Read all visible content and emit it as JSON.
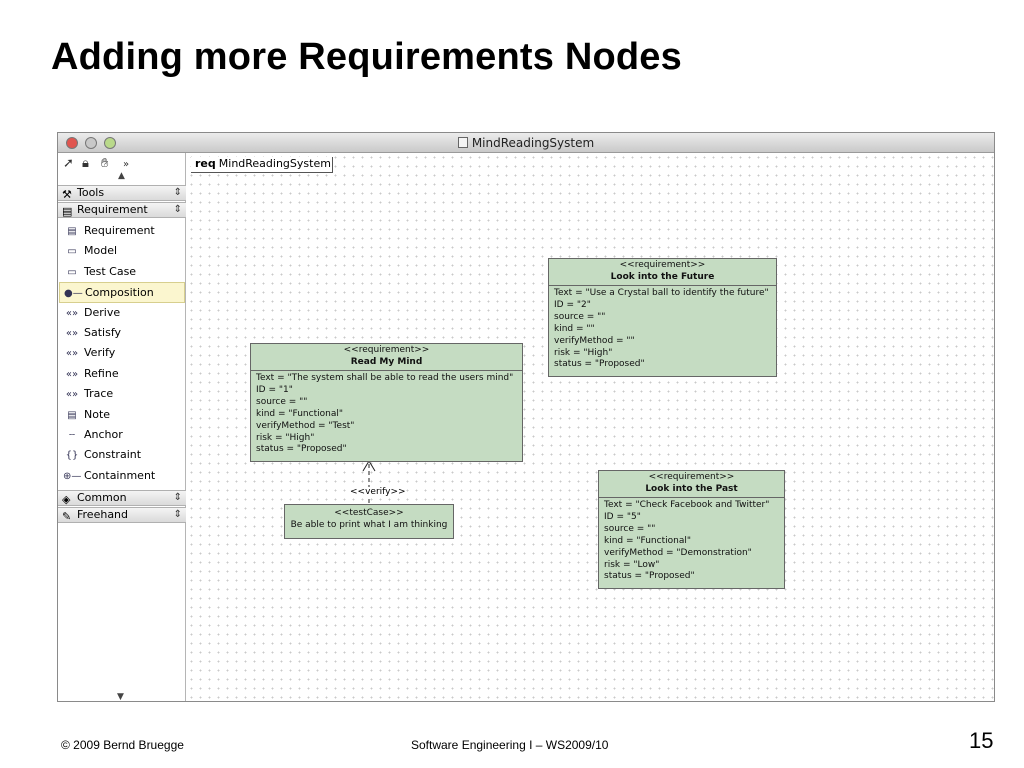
{
  "slide": {
    "title": "Adding more Requirements Nodes",
    "footer_left": "© 2009 Bernd Bruegge",
    "footer_center": "Software Engineering I – WS2009/10",
    "page_number": "15"
  },
  "window": {
    "title": "MindReadingSystem"
  },
  "palette": {
    "toolbar_icons": [
      "pointer-icon",
      "lock-icon",
      "hand-icon",
      "more-icon"
    ],
    "sections": {
      "tools": "Tools",
      "requirement": "Requirement",
      "common": "Common",
      "freehand": "Freehand"
    },
    "items": [
      {
        "label": "Requirement",
        "icon": "requirement-icon",
        "glyph": "▤"
      },
      {
        "label": "Model",
        "icon": "model-icon",
        "glyph": "▭"
      },
      {
        "label": "Test Case",
        "icon": "test-case-icon",
        "glyph": "▭"
      },
      {
        "label": "Composition",
        "icon": "composition-icon",
        "glyph": "●—"
      },
      {
        "label": "Derive",
        "icon": "derive-icon",
        "glyph": "«»"
      },
      {
        "label": "Satisfy",
        "icon": "satisfy-icon",
        "glyph": "«»"
      },
      {
        "label": "Verify",
        "icon": "verify-icon",
        "glyph": "«»"
      },
      {
        "label": "Refine",
        "icon": "refine-icon",
        "glyph": "«»"
      },
      {
        "label": "Trace",
        "icon": "trace-icon",
        "glyph": "«»"
      },
      {
        "label": "Note",
        "icon": "note-icon",
        "glyph": "▤"
      },
      {
        "label": "Anchor",
        "icon": "anchor-icon",
        "glyph": "┄"
      },
      {
        "label": "Constraint",
        "icon": "constraint-icon",
        "glyph": "{}"
      },
      {
        "label": "Containment",
        "icon": "containment-icon",
        "glyph": "⊕—"
      }
    ],
    "selected_item": "Composition"
  },
  "canvas": {
    "diagram_kind": "req",
    "diagram_name": "MindReadingSystem",
    "nodes": {
      "future": {
        "stereotype": "<<requirement>>",
        "name": "Look into the Future",
        "props": [
          "Text = \"Use a Crystal ball to identify the future\"",
          "ID = \"2\"",
          "source = \"\"",
          "kind = \"\"",
          "verifyMethod = \"\"",
          "risk = \"High\"",
          "status = \"Proposed\""
        ]
      },
      "mind": {
        "stereotype": "<<requirement>>",
        "name": "Read My Mind",
        "props": [
          "Text = \"The system shall be able to read the users mind\"",
          "ID = \"1\"",
          "source = \"\"",
          "kind = \"Functional\"",
          "verifyMethod = \"Test\"",
          "risk = \"High\"",
          "status = \"Proposed\""
        ]
      },
      "past": {
        "stereotype": "<<requirement>>",
        "name": "Look into the Past",
        "props": [
          "Text = \"Check Facebook and Twitter\"",
          "ID = \"5\"",
          "source = \"\"",
          "kind = \"Functional\"",
          "verifyMethod = \"Demonstration\"",
          "risk = \"Low\"",
          "status = \"Proposed\""
        ]
      },
      "testcase": {
        "stereotype": "<<testCase>>",
        "text": "Be able to print what I am thinking"
      }
    },
    "verify_label": "<<verify>>"
  },
  "colors": {
    "node_fill": "#c5dcc2",
    "selection_fill": "#fbf6cf"
  }
}
